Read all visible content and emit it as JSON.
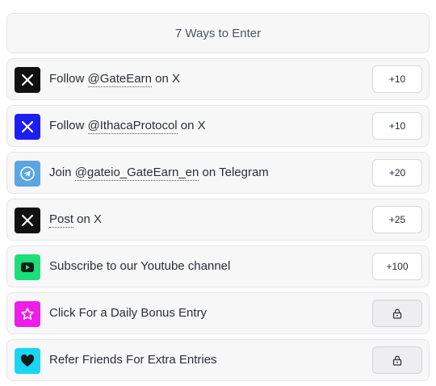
{
  "header": {
    "title": "7 Ways to Enter"
  },
  "entries": [
    {
      "icon": "x-logo-icon",
      "icon_bg": "#111111",
      "prefix": "Follow ",
      "link": "@GateEarn",
      "suffix": " on X",
      "action": "+10",
      "locked": false
    },
    {
      "icon": "x-logo-icon",
      "icon_bg": "#1d1df5",
      "prefix": "Follow ",
      "link": "@IthacaProtocol",
      "suffix": " on X",
      "action": "+10",
      "locked": false
    },
    {
      "icon": "telegram-icon",
      "icon_bg": "#5aa6e3",
      "prefix": "Join ",
      "link": "@gateio_GateEarn_en",
      "suffix": " on Telegram",
      "action": "+20",
      "locked": false
    },
    {
      "icon": "x-logo-icon",
      "icon_bg": "#111111",
      "prefix": "",
      "link": "Post",
      "suffix": " on X",
      "action": "+25",
      "locked": false
    },
    {
      "icon": "youtube-icon",
      "icon_bg": "#19e07a",
      "prefix": "Subscribe to our Youtube channel",
      "link": "",
      "suffix": "",
      "action": "+100",
      "locked": false
    },
    {
      "icon": "star-icon",
      "icon_bg": "#ee1de8",
      "prefix": "Click For a Daily Bonus Entry",
      "link": "",
      "suffix": "",
      "action": "lock-icon",
      "locked": true
    },
    {
      "icon": "heart-icon",
      "icon_bg": "#19d6f2",
      "prefix": "Refer Friends For Extra Entries",
      "link": "",
      "suffix": "",
      "action": "lock-icon",
      "locked": true
    }
  ]
}
